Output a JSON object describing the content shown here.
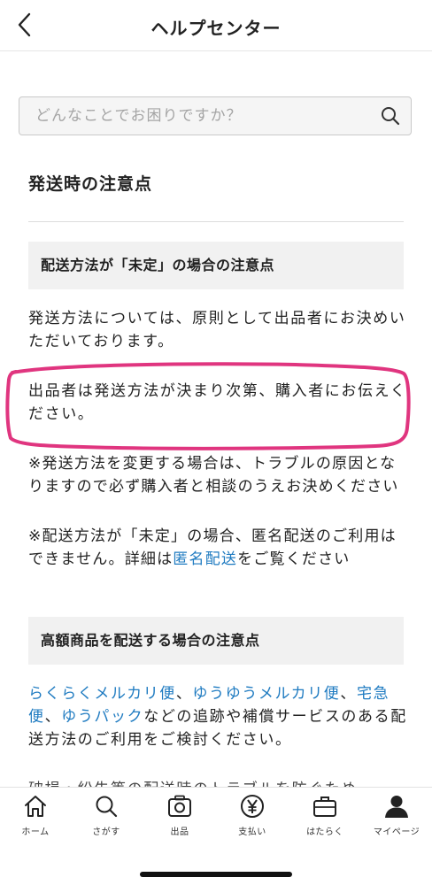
{
  "header": {
    "title": "ヘルプセンター"
  },
  "search": {
    "placeholder": "どんなことでお困りですか？"
  },
  "article": {
    "title": "発送時の注意点",
    "section1": {
      "heading": "配送方法が「未定」の場合の注意点",
      "p1": "発送方法については、原則として出品者にお決めいただいております。",
      "p2": "出品者は発送方法が決まり次第、購入者にお伝えください。",
      "note1": "※発送方法を変更する場合は、トラブルの原因となりますので必ず購入者と相談のうえお決めください",
      "note2_pre": "※配送方法が「未定」の場合、匿名配送のご利用はできません。詳細は",
      "note2_link": "匿名配送",
      "note2_post": "をご覧ください"
    },
    "section2": {
      "heading": "高額商品を配送する場合の注意点",
      "link1": "らくらくメルカリ便",
      "sep1": "、",
      "link2": "ゆうゆうメルカリ便",
      "sep2": "、",
      "link3": "宅急便",
      "sep3": "、",
      "link4": "ゆうパック",
      "tail": "などの追跡や補償サービスのある配送方法のご利用をご検討ください。",
      "cut_line": "破損・紛失等の配送時のトラブルを防ぐため"
    }
  },
  "tabbar": {
    "home": "ホーム",
    "search": "さがす",
    "sell": "出品",
    "pay": "支払い",
    "work": "はたらく",
    "mypage": "マイページ"
  },
  "colors": {
    "link": "#1f7bc1",
    "highlight": "#e0357f",
    "section_bg": "#f1f1f1"
  }
}
